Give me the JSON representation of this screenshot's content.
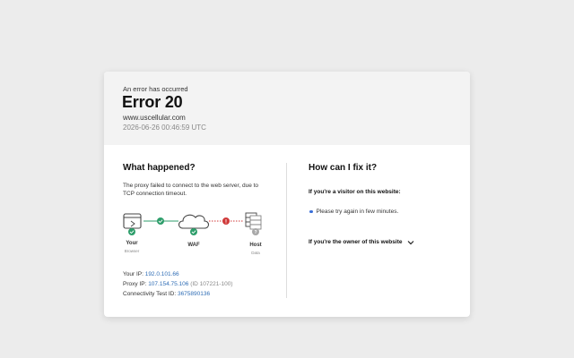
{
  "header": {
    "subtitle": "An error has occurred",
    "title": "Error 20",
    "host": "www.uscellular.com",
    "timestamp": "2026-06-26 00:46:59 UTC"
  },
  "left": {
    "heading": "What happened?",
    "description": "The proxy failed to connect to the web server, due to TCP connection timeout.",
    "nodes": [
      {
        "label": "Your",
        "sub": "Browser",
        "status": "ok"
      },
      {
        "label": "WAF",
        "sub": "",
        "status": "ok"
      },
      {
        "label": "Host",
        "sub": "Data",
        "status": "unknown"
      }
    ],
    "links": [
      {
        "status": "ok"
      },
      {
        "status": "error",
        "marker": "!"
      }
    ],
    "your_ip_label": "Your IP:",
    "your_ip": "192.0.101.66",
    "proxy_ip_label": "Proxy IP:",
    "proxy_ip": "107.154.75.106",
    "proxy_id": "(ID 107221-100)",
    "test_id_label": "Connectivity Test ID:",
    "test_id": "3675890136"
  },
  "right": {
    "heading": "How can I fix it?",
    "visitor_heading": "If you're a visitor on this website:",
    "visitor_tip": "Please try again in few minutes.",
    "owner_heading": "If you're the owner of this website"
  },
  "colors": {
    "ok": "#2e9e6b",
    "error": "#d03a3a",
    "unknown": "#a8a8a8",
    "link": "#2f6db5",
    "bullet": "#3a6fd8"
  }
}
